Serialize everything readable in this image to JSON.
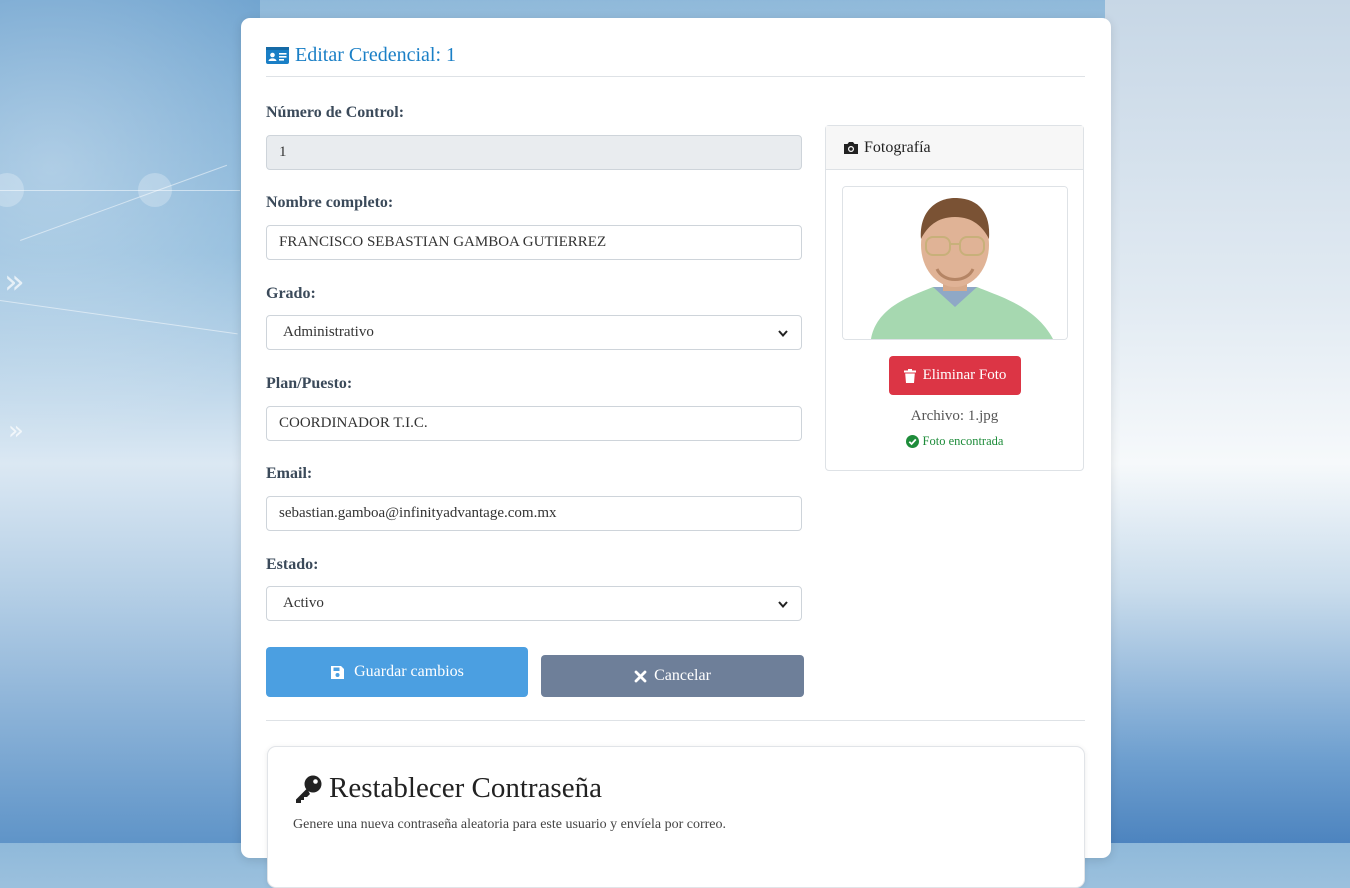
{
  "header": {
    "title": "Editar Credencial: 1"
  },
  "form": {
    "control_label": "Número de Control:",
    "control_value": "1",
    "name_label": "Nombre completo:",
    "name_value": "FRANCISCO SEBASTIAN GAMBOA GUTIERREZ",
    "grado_label": "Grado:",
    "grado_value": "Administrativo",
    "plan_label": "Plan/Puesto:",
    "plan_value": "COORDINADOR T.I.C.",
    "email_label": "Email:",
    "email_value": "sebastian.gamboa@infinityadvantage.com.mx",
    "estado_label": "Estado:",
    "estado_value": "Activo"
  },
  "actions": {
    "save_label": "Guardar cambios",
    "cancel_label": "Cancelar"
  },
  "photo": {
    "title": "Fotografía",
    "delete_label": "Eliminar Foto",
    "file_text": "Archivo: 1.jpg",
    "status_text": "Foto encontrada"
  },
  "reset": {
    "title": "Restablecer Contraseña",
    "description": "Genere una nueva contraseña aleatoria para este usuario y envíela por correo."
  },
  "colors": {
    "accent": "#1a7fc6",
    "save": "#4b9fe1",
    "cancel": "#6e7f99",
    "danger": "#dc3545",
    "success": "#1e8c3a"
  },
  "icons": [
    "id-card-icon",
    "camera-icon",
    "trash-icon",
    "check-circle-icon",
    "floppy-disk-icon",
    "close-icon",
    "key-icon",
    "chevron-down-icon"
  ]
}
